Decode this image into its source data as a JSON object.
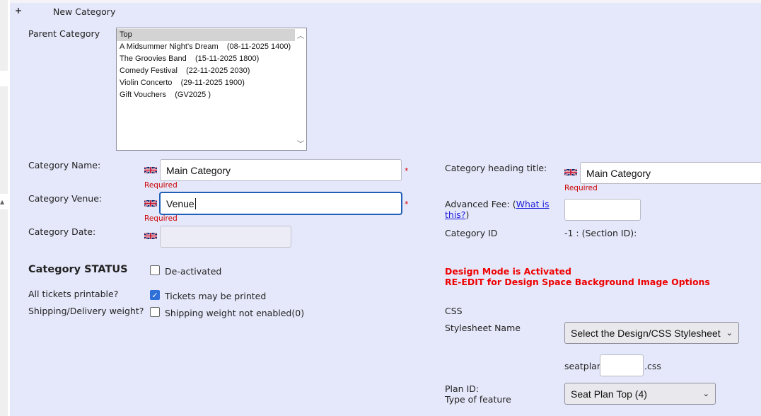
{
  "header": {
    "expand_icon": "+",
    "title": "New Category"
  },
  "parent_category": {
    "label": "Parent Category",
    "options": [
      "Top",
      "A Midsummer Night's Dream    (08-11-2025 1400)",
      "The Groovies Band    (15-11-2025 1800)",
      "Comedy Festival    (22-11-2025 2030)",
      "Violin Concerto    (29-11-2025 1900)",
      "Gift Vouchers    (GV2025 )"
    ],
    "selected": "Top"
  },
  "left_form": {
    "category_name": {
      "label": "Category Name:",
      "value": "Main Category",
      "required_mark": "*",
      "required_text": "Required"
    },
    "category_venue": {
      "label": "Category Venue:",
      "value": "Venue",
      "required_mark": "*",
      "required_text": "Required"
    },
    "category_date": {
      "label": "Category Date:",
      "value": ""
    }
  },
  "status": {
    "heading": "Category STATUS",
    "deactivated_label": "De-activated",
    "printable_label": "All tickets printable?",
    "printable_checkbox_label": "Tickets may be printed",
    "shipping_label": "Shipping/Delivery weight?",
    "shipping_checkbox_label": "Shipping weight not enabled(0)"
  },
  "right_form": {
    "heading_title": {
      "label": "Category heading title:",
      "value": "Main Category",
      "required_text": "Required"
    },
    "advanced_fee": {
      "label_prefix": "Advanced Fee: (",
      "link_line1": "What is",
      "link_line2": "this?",
      "label_suffix": ")",
      "value": ""
    },
    "category_id": {
      "label": "Category ID",
      "value": "-1 : (Section ID):"
    },
    "design_mode": {
      "line1": "Design Mode is Activated",
      "line2": "RE-EDIT for Design Space Background Image Options"
    },
    "css_label": "CSS",
    "stylesheet": {
      "label": "Stylesheet Name",
      "selected": "Select the Design/CSS Stylesheet"
    },
    "seatplan": {
      "prefix": "seatplan",
      "value": "",
      "suffix": ".css"
    },
    "plan_id": {
      "label_line1": "Plan ID:",
      "label_line2": "Type of feature",
      "selected": "Seat Plan Top (4)"
    }
  },
  "icons": {
    "flag": "uk-flag-icon",
    "checkbox_checked": "check-icon",
    "select_arrow": "chevron-down-icon"
  },
  "colors": {
    "panel": "#e5e8fa",
    "required": "#cc0000",
    "design_mode": "#ee0000",
    "link": "#1a1adb",
    "focus": "#1f5fb8"
  }
}
